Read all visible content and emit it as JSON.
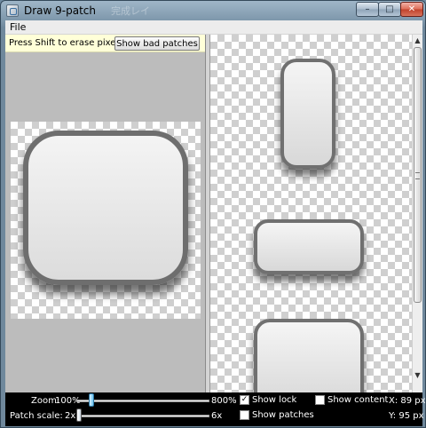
{
  "window": {
    "title": "Draw 9-patch",
    "ghost_title": "完成レイ",
    "controls": {
      "minimize": "–",
      "maximize": "□",
      "close": "✕"
    }
  },
  "menu": {
    "file": "File"
  },
  "editor": {
    "status_text": "Press Shift to erase pixels",
    "bad_patches_button": "Show bad patches"
  },
  "scrollbar": {
    "up_arrow": "▲",
    "down_arrow": "▼"
  },
  "controls": {
    "zoom_label": "Zoom:",
    "zoom_min": "100%",
    "zoom_max": "800%",
    "zoom_level": 0.1,
    "patch_scale_label": "Patch scale:",
    "patch_scale_min": "2x",
    "patch_scale_max": "6x",
    "patch_scale_level": 0.0,
    "show_lock": {
      "label": "Show lock",
      "checked": true,
      "mark": "✓"
    },
    "show_patches": {
      "label": "Show patches",
      "checked": false
    },
    "show_content": {
      "label": "Show content",
      "checked": false
    },
    "x_readout": "X: 89 px",
    "y_readout": "Y: 95 px"
  },
  "icons": [
    "app-icon",
    "minimize-icon",
    "maximize-icon",
    "close-icon",
    "scroll-up-icon",
    "scroll-down-icon",
    "check-icon"
  ]
}
